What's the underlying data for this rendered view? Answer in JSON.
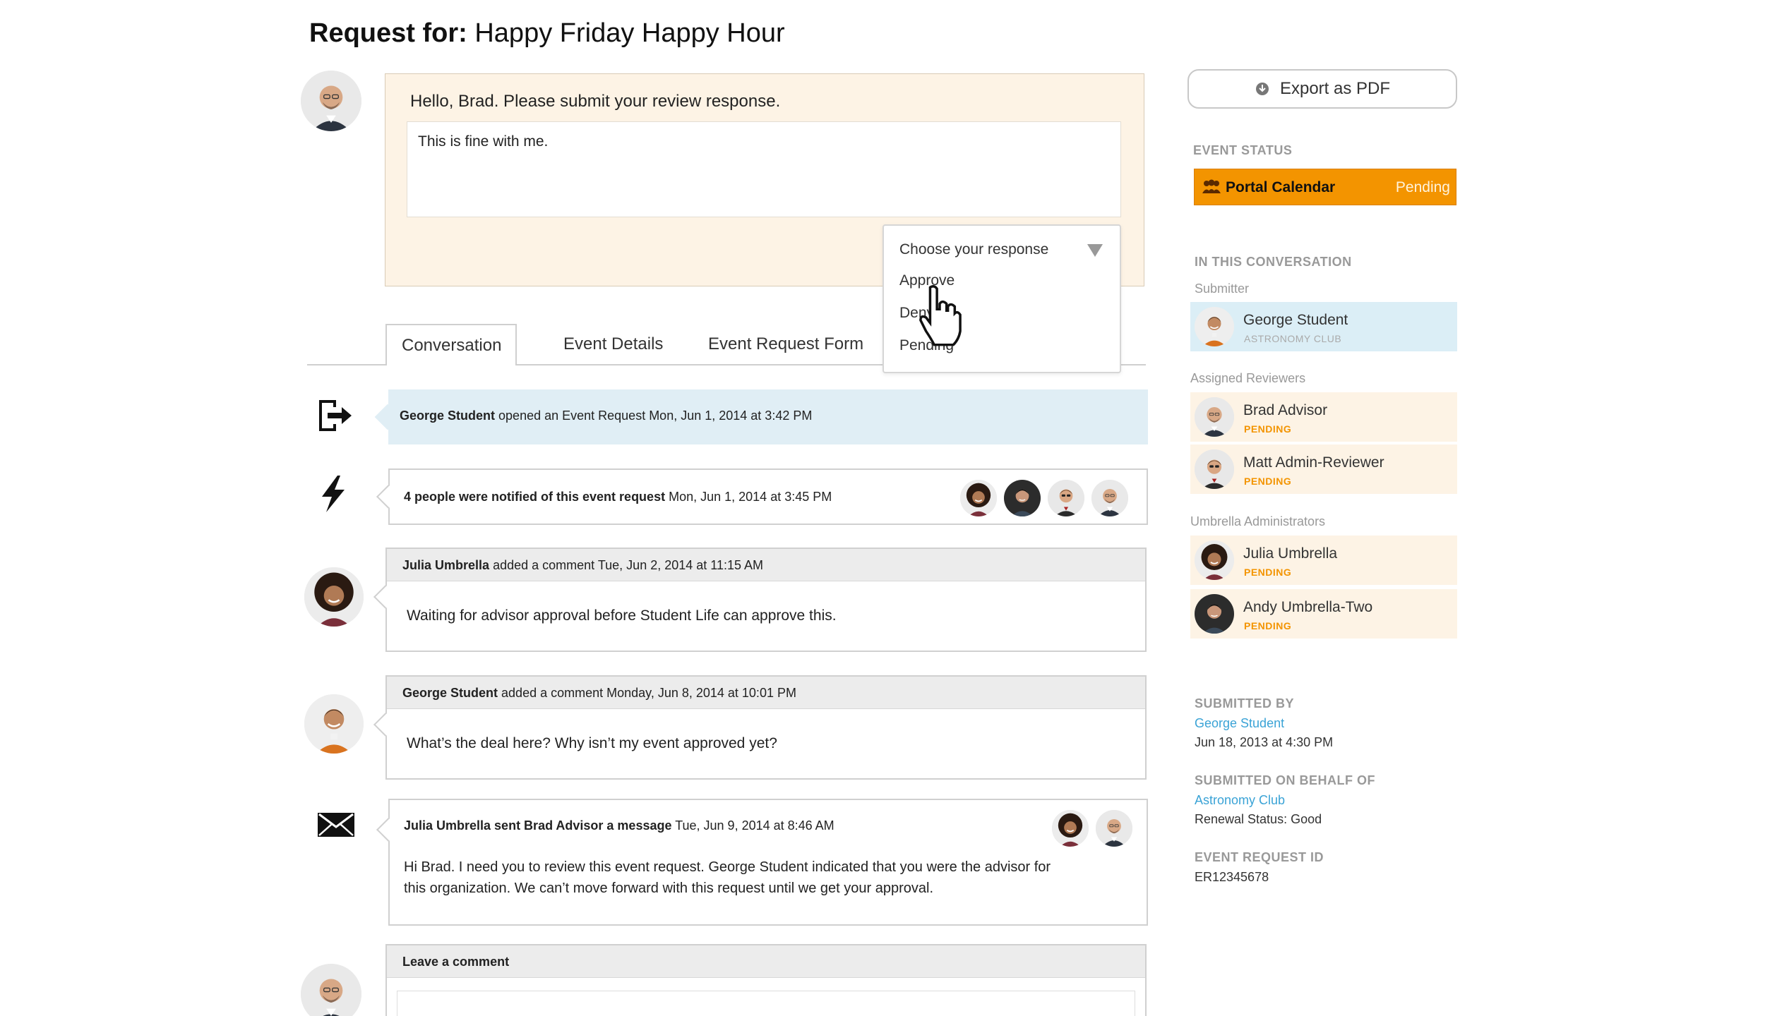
{
  "header": {
    "title_prefix": "Request for:",
    "title": "Happy Friday Happy Hour"
  },
  "review": {
    "prompt": "Hello, Brad. Please submit your review response.",
    "response_text": "This is fine with me.",
    "dropdown": {
      "placeholder": "Choose your response",
      "options": [
        "Approve",
        "Deny",
        "Pending"
      ]
    }
  },
  "tabs": [
    {
      "label": "Conversation",
      "active": true
    },
    {
      "label": "Event Details",
      "active": false
    },
    {
      "label": "Event Request Form",
      "active": false
    }
  ],
  "feed": {
    "opened": {
      "who": "George Student",
      "text": "opened an Event Request Mon, Jun 1, 2014 at 3:42 PM"
    },
    "notified": {
      "bold": "4 people were notified of this event request",
      "text": "Mon, Jun 1, 2014 at 3:45 PM"
    },
    "comments": [
      {
        "who": "Julia Umbrella",
        "meta": "added a comment Tue, Jun 2, 2014 at 11:15 AM",
        "body": "Waiting for advisor approval before Student Life can approve this."
      },
      {
        "who": "George Student",
        "meta": "added a comment Monday, Jun 8, 2014 at 10:01 PM",
        "body": "What’s the deal here? Why isn’t my event approved yet?"
      }
    ],
    "message": {
      "bold": "Julia Umbrella sent Brad Advisor a message",
      "meta": "Tue, Jun 9, 2014 at 8:46 AM",
      "body_line1": "Hi Brad. I need you to review this event request. George Student indicated that you were the advisor for",
      "body_line2": "this organization. We can’t move forward with this request until we get your approval."
    },
    "leave_comment": "Leave a comment"
  },
  "sidebar": {
    "export_label": "Export as PDF",
    "event_status_heading": "EVENT STATUS",
    "calendar": {
      "name": "Portal Calendar",
      "status": "Pending"
    },
    "conversation_heading": "IN THIS CONVERSATION",
    "submitter_label": "Submitter",
    "submitter": {
      "name": "George Student",
      "org": "ASTRONOMY CLUB"
    },
    "reviewers_label": "Assigned Reviewers",
    "reviewers": [
      {
        "name": "Brad Advisor",
        "status": "PENDING"
      },
      {
        "name": "Matt Admin-Reviewer",
        "status": "PENDING"
      }
    ],
    "admins_label": "Umbrella Administrators",
    "admins": [
      {
        "name": "Julia Umbrella",
        "status": "PENDING"
      },
      {
        "name": "Andy Umbrella-Two",
        "status": "PENDING"
      }
    ],
    "submitted_by_heading": "SUBMITTED BY",
    "submitted_by_name": "George Student",
    "submitted_by_date": "Jun 18, 2013 at 4:30 PM",
    "behalf_heading": "SUBMITTED ON BEHALF OF",
    "behalf_name": "Astronomy Club",
    "behalf_status": "Renewal Status: Good",
    "request_id_heading": "EVENT REQUEST ID",
    "request_id": "ER12345678"
  },
  "colors": {
    "accent_orange": "#f39400",
    "link_blue": "#3aa3d6",
    "review_bg": "#fdf3e5",
    "highlight_blue": "#dbeef6"
  }
}
